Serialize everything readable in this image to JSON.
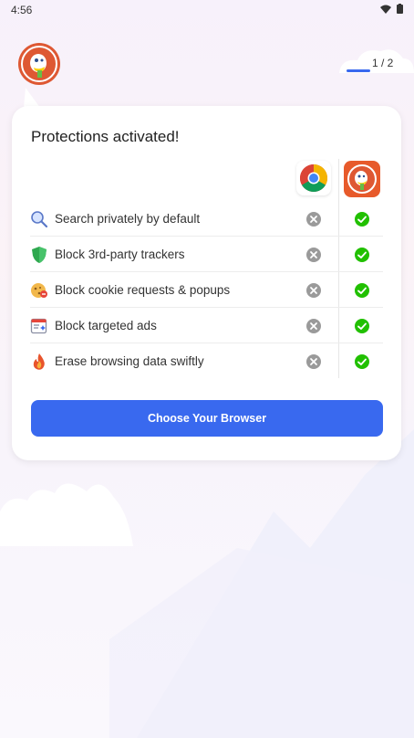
{
  "status_bar": {
    "time": "4:56"
  },
  "onboarding": {
    "page_indicator": "1 / 2",
    "progress_fraction": 0.5
  },
  "card": {
    "title": "Protections activated!",
    "browsers": [
      {
        "name": "Chrome",
        "icon": "chrome-icon"
      },
      {
        "name": "DuckDuckGo",
        "icon": "duckduckgo-icon"
      }
    ],
    "features": [
      {
        "label": "Search privately by default",
        "icon": "magnifier-icon",
        "chrome": false,
        "duckduckgo": true
      },
      {
        "label": "Block 3rd-party trackers",
        "icon": "shield-icon",
        "chrome": false,
        "duckduckgo": true
      },
      {
        "label": "Block cookie requests & popups",
        "icon": "cookie-icon",
        "chrome": false,
        "duckduckgo": true
      },
      {
        "label": "Block targeted ads",
        "icon": "ad-block-icon",
        "chrome": false,
        "duckduckgo": true
      },
      {
        "label": "Erase browsing data swiftly",
        "icon": "fire-icon",
        "chrome": false,
        "duckduckgo": true
      }
    ],
    "cta_label": "Choose Your Browser"
  },
  "colors": {
    "accent": "#3969ef",
    "check": "#21c000",
    "x": "#9a9a9a",
    "ddg_orange": "#de5833"
  }
}
